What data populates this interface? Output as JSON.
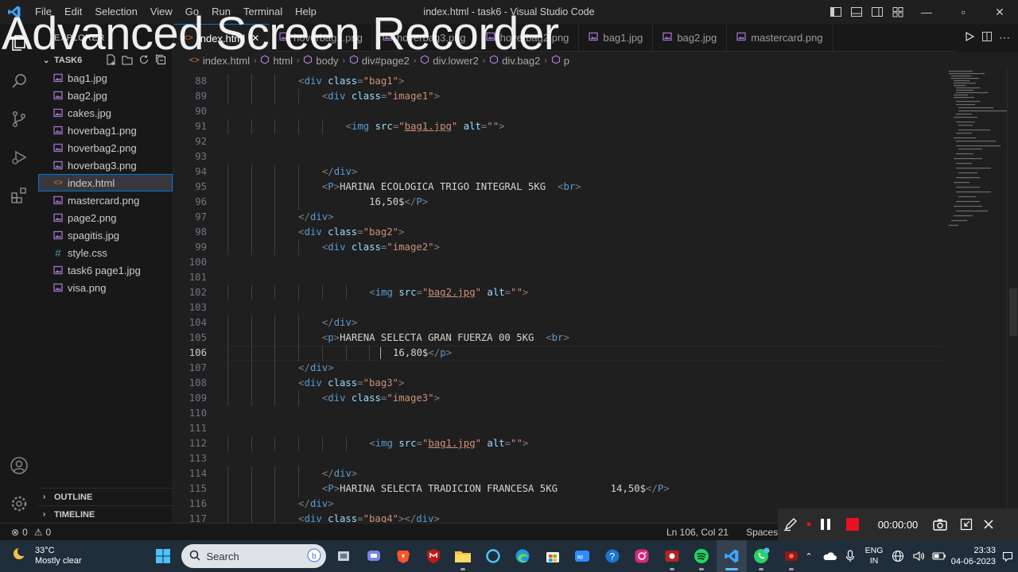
{
  "window": {
    "title": "index.html - task6 - Visual Studio Code",
    "menu": [
      "File",
      "Edit",
      "Selection",
      "View",
      "Go",
      "Run",
      "Terminal",
      "Help"
    ]
  },
  "watermark": "Advanced Screen Recorder",
  "sidebar": {
    "header": "EXPLORER",
    "folder": "TASK6",
    "files": [
      {
        "name": "bag1.jpg",
        "icon": "image-file-icon"
      },
      {
        "name": "bag2.jpg",
        "icon": "image-file-icon"
      },
      {
        "name": "cakes.jpg",
        "icon": "image-file-icon"
      },
      {
        "name": "hoverbag1.png",
        "icon": "image-file-icon"
      },
      {
        "name": "hoverbag2.png",
        "icon": "image-file-icon"
      },
      {
        "name": "hoverbag3.png",
        "icon": "image-file-icon"
      },
      {
        "name": "index.html",
        "icon": "html-file-icon",
        "active": true
      },
      {
        "name": "mastercard.png",
        "icon": "image-file-icon"
      },
      {
        "name": "page2.png",
        "icon": "image-file-icon"
      },
      {
        "name": "spagitis.jpg",
        "icon": "image-file-icon"
      },
      {
        "name": "style.css",
        "icon": "css-file-icon"
      },
      {
        "name": "task6 page1.jpg",
        "icon": "image-file-icon"
      },
      {
        "name": "visa.png",
        "icon": "image-file-icon"
      }
    ],
    "outline": "OUTLINE",
    "timeline": "TIMELINE"
  },
  "tabs": [
    {
      "label": "index.html",
      "active": true
    },
    {
      "label": "hoverbag1.png"
    },
    {
      "label": "hoverbag3.png"
    },
    {
      "label": "hoverbag2.png"
    },
    {
      "label": "bag1.jpg"
    },
    {
      "label": "bag2.jpg"
    },
    {
      "label": "mastercard.png"
    }
  ],
  "breadcrumb": [
    "index.html",
    "html",
    "body",
    "div#page2",
    "div.lower2",
    "div.bag2",
    "p"
  ],
  "editor": {
    "current_line": 106,
    "lines": [
      {
        "n": 88,
        "indent": 3,
        "tokens": [
          [
            "t",
            "<"
          ],
          [
            "n",
            "div"
          ],
          [
            "a",
            " class"
          ],
          [
            "t",
            "="
          ],
          [
            "s",
            "\"bag1\""
          ],
          [
            "t",
            ">"
          ]
        ]
      },
      {
        "n": 89,
        "indent": 4,
        "tokens": [
          [
            "t",
            "<"
          ],
          [
            "n",
            "div"
          ],
          [
            "a",
            " class"
          ],
          [
            "t",
            "="
          ],
          [
            "s",
            "\"image1\""
          ],
          [
            "t",
            ">"
          ]
        ]
      },
      {
        "n": 90,
        "indent": 0,
        "tokens": []
      },
      {
        "n": 91,
        "indent": 5,
        "tokens": [
          [
            "t",
            "<"
          ],
          [
            "n",
            "img"
          ],
          [
            "a",
            " src"
          ],
          [
            "t",
            "="
          ],
          [
            "s",
            "\""
          ],
          [
            "u",
            "bag1.jpg"
          ],
          [
            "s",
            "\""
          ],
          [
            "a",
            " alt"
          ],
          [
            "t",
            "="
          ],
          [
            "s",
            "\"\""
          ],
          [
            "t",
            ">"
          ]
        ]
      },
      {
        "n": 92,
        "indent": 0,
        "tokens": []
      },
      {
        "n": 93,
        "indent": 0,
        "tokens": []
      },
      {
        "n": 94,
        "indent": 4,
        "tokens": [
          [
            "t",
            "</"
          ],
          [
            "n",
            "div"
          ],
          [
            "t",
            ">"
          ]
        ]
      },
      {
        "n": 95,
        "indent": 4,
        "tokens": [
          [
            "t",
            "<"
          ],
          [
            "n",
            "P"
          ],
          [
            "t",
            ">"
          ],
          [
            "x",
            "HARINA ECOLOGICA TRIGO INTEGRAL 5KG  "
          ],
          [
            "t",
            "<"
          ],
          [
            "n",
            "br"
          ],
          [
            "t",
            ">"
          ]
        ]
      },
      {
        "n": 96,
        "indent": 4,
        "tokens": [
          [
            "x",
            "        16,50$"
          ],
          [
            "t",
            "</"
          ],
          [
            "n",
            "P"
          ],
          [
            "t",
            ">"
          ]
        ]
      },
      {
        "n": 97,
        "indent": 3,
        "tokens": [
          [
            "t",
            "</"
          ],
          [
            "n",
            "div"
          ],
          [
            "t",
            ">"
          ]
        ]
      },
      {
        "n": 98,
        "indent": 3,
        "tokens": [
          [
            "t",
            "<"
          ],
          [
            "n",
            "div"
          ],
          [
            "a",
            " class"
          ],
          [
            "t",
            "="
          ],
          [
            "s",
            "\"bag2\""
          ],
          [
            "t",
            ">"
          ]
        ]
      },
      {
        "n": 99,
        "indent": 4,
        "tokens": [
          [
            "t",
            "<"
          ],
          [
            "n",
            "div"
          ],
          [
            "a",
            " class"
          ],
          [
            "t",
            "="
          ],
          [
            "s",
            "\"image2\""
          ],
          [
            "t",
            ">"
          ]
        ]
      },
      {
        "n": 100,
        "indent": 0,
        "tokens": []
      },
      {
        "n": 101,
        "indent": 0,
        "tokens": []
      },
      {
        "n": 102,
        "indent": 6,
        "tokens": [
          [
            "t",
            "<"
          ],
          [
            "n",
            "img"
          ],
          [
            "a",
            " src"
          ],
          [
            "t",
            "="
          ],
          [
            "s",
            "\""
          ],
          [
            "u",
            "bag2.jpg"
          ],
          [
            "s",
            "\""
          ],
          [
            "a",
            " alt"
          ],
          [
            "t",
            "="
          ],
          [
            "s",
            "\"\""
          ],
          [
            "t",
            ">"
          ]
        ]
      },
      {
        "n": 103,
        "indent": 0,
        "tokens": []
      },
      {
        "n": 104,
        "indent": 4,
        "tokens": [
          [
            "t",
            "</"
          ],
          [
            "n",
            "div"
          ],
          [
            "t",
            ">"
          ]
        ]
      },
      {
        "n": 105,
        "indent": 4,
        "tokens": [
          [
            "t",
            "<"
          ],
          [
            "n",
            "p"
          ],
          [
            "t",
            ">"
          ],
          [
            "x",
            "HARENA SELECTA GRAN FUERZA 00 5KG  "
          ],
          [
            "t",
            "<"
          ],
          [
            "n",
            "br"
          ],
          [
            "t",
            ">"
          ]
        ]
      },
      {
        "n": 106,
        "indent": 7,
        "tokens": [
          [
            "x",
            "16,80$"
          ],
          [
            "t",
            "</"
          ],
          [
            "n",
            "p"
          ],
          [
            "t",
            ">"
          ]
        ]
      },
      {
        "n": 107,
        "indent": 3,
        "tokens": [
          [
            "t",
            "</"
          ],
          [
            "n",
            "div"
          ],
          [
            "t",
            ">"
          ]
        ]
      },
      {
        "n": 108,
        "indent": 3,
        "tokens": [
          [
            "t",
            "<"
          ],
          [
            "n",
            "div"
          ],
          [
            "a",
            " class"
          ],
          [
            "t",
            "="
          ],
          [
            "s",
            "\"bag3\""
          ],
          [
            "t",
            ">"
          ]
        ]
      },
      {
        "n": 109,
        "indent": 4,
        "tokens": [
          [
            "t",
            "<"
          ],
          [
            "n",
            "div"
          ],
          [
            "a",
            " class"
          ],
          [
            "t",
            "="
          ],
          [
            "s",
            "\"image3\""
          ],
          [
            "t",
            ">"
          ]
        ]
      },
      {
        "n": 110,
        "indent": 0,
        "tokens": []
      },
      {
        "n": 111,
        "indent": 0,
        "tokens": []
      },
      {
        "n": 112,
        "indent": 6,
        "tokens": [
          [
            "t",
            "<"
          ],
          [
            "n",
            "img"
          ],
          [
            "a",
            " src"
          ],
          [
            "t",
            "="
          ],
          [
            "s",
            "\""
          ],
          [
            "u",
            "bag1.jpg"
          ],
          [
            "s",
            "\""
          ],
          [
            "a",
            " alt"
          ],
          [
            "t",
            "="
          ],
          [
            "s",
            "\"\""
          ],
          [
            "t",
            ">"
          ]
        ]
      },
      {
        "n": 113,
        "indent": 0,
        "tokens": []
      },
      {
        "n": 114,
        "indent": 4,
        "tokens": [
          [
            "t",
            "</"
          ],
          [
            "n",
            "div"
          ],
          [
            "t",
            ">"
          ]
        ]
      },
      {
        "n": 115,
        "indent": 4,
        "tokens": [
          [
            "t",
            "<"
          ],
          [
            "n",
            "P"
          ],
          [
            "t",
            ">"
          ],
          [
            "x",
            "HARINA SELECTA TRADICION FRANCESA 5KG         14,50$"
          ],
          [
            "t",
            "</"
          ],
          [
            "n",
            "P"
          ],
          [
            "t",
            ">"
          ]
        ]
      },
      {
        "n": 116,
        "indent": 3,
        "tokens": [
          [
            "t",
            "</"
          ],
          [
            "n",
            "div"
          ],
          [
            "t",
            ">"
          ]
        ]
      },
      {
        "n": 117,
        "indent": 3,
        "tokens": [
          [
            "t",
            "<"
          ],
          [
            "n",
            "div"
          ],
          [
            "a",
            " class"
          ],
          [
            "t",
            "="
          ],
          [
            "s",
            "\"bag4\""
          ],
          [
            "t",
            ">"
          ],
          [
            "t",
            "</"
          ],
          [
            "n",
            "div"
          ],
          [
            "t",
            ">"
          ]
        ]
      }
    ]
  },
  "statusbar": {
    "errors": "0",
    "warnings": "0",
    "position": "Ln 106, Col 21",
    "spaces": "Spaces: 4"
  },
  "recorder": {
    "time": "00:00:00"
  },
  "taskbar": {
    "weather_temp": "33°C",
    "weather_desc": "Mostly clear",
    "search_placeholder": "Search",
    "lang_top": "ENG",
    "lang_bottom": "IN",
    "time": "23:33",
    "date": "04-06-2023"
  },
  "colors": {
    "accent": "#0078d4",
    "tag_bracket": "#808080",
    "tag_name": "#569cd6",
    "attr": "#9cdcfe",
    "string": "#ce9178",
    "record_red": "#e81123"
  }
}
